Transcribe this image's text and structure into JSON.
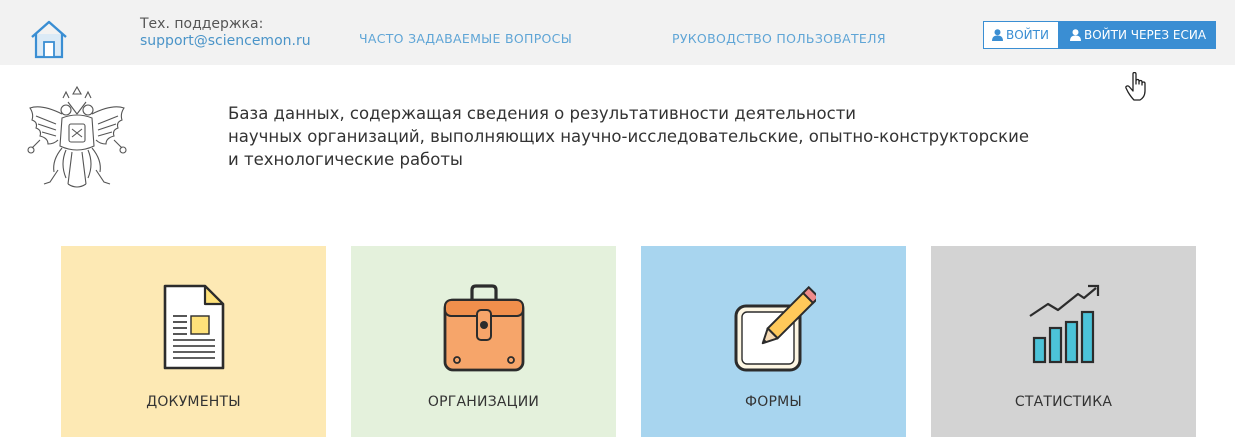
{
  "header": {
    "support_label": "Тех. поддержка:",
    "support_email": "support@sciencemon.ru",
    "nav": {
      "faq": "ЧАСТО ЗАДАВАЕМЫЕ ВОПРОСЫ",
      "guide": "РУКОВОДСТВО ПОЛЬЗОВАТЕЛЯ"
    },
    "login_label": "ВОЙТИ",
    "esia_login_label": "ВОЙТИ ЧЕРЕЗ ЕСИА"
  },
  "intro": {
    "line1": "База данных, содержащая сведения о результативности деятельности",
    "line2": "научных организаций, выполняющих научно-исследовательские, опытно-конструкторские",
    "line3": "и технологические работы"
  },
  "tiles": [
    {
      "label": "ДОКУМЕНТЫ",
      "color": "#fde9b4",
      "icon": "document-icon"
    },
    {
      "label": "ОРГАНИЗАЦИИ",
      "color": "#e4f1dc",
      "icon": "briefcase-icon"
    },
    {
      "label": "ФОРМЫ",
      "color": "#a8d5ef",
      "icon": "form-pencil-icon"
    },
    {
      "label": "СТАТИСТИКА",
      "color": "#d3d3d3",
      "icon": "statistics-chart-icon"
    }
  ],
  "colors": {
    "accent": "#3a8ed3",
    "link": "#5fa5d6",
    "topbar": "#f2f2f2"
  }
}
